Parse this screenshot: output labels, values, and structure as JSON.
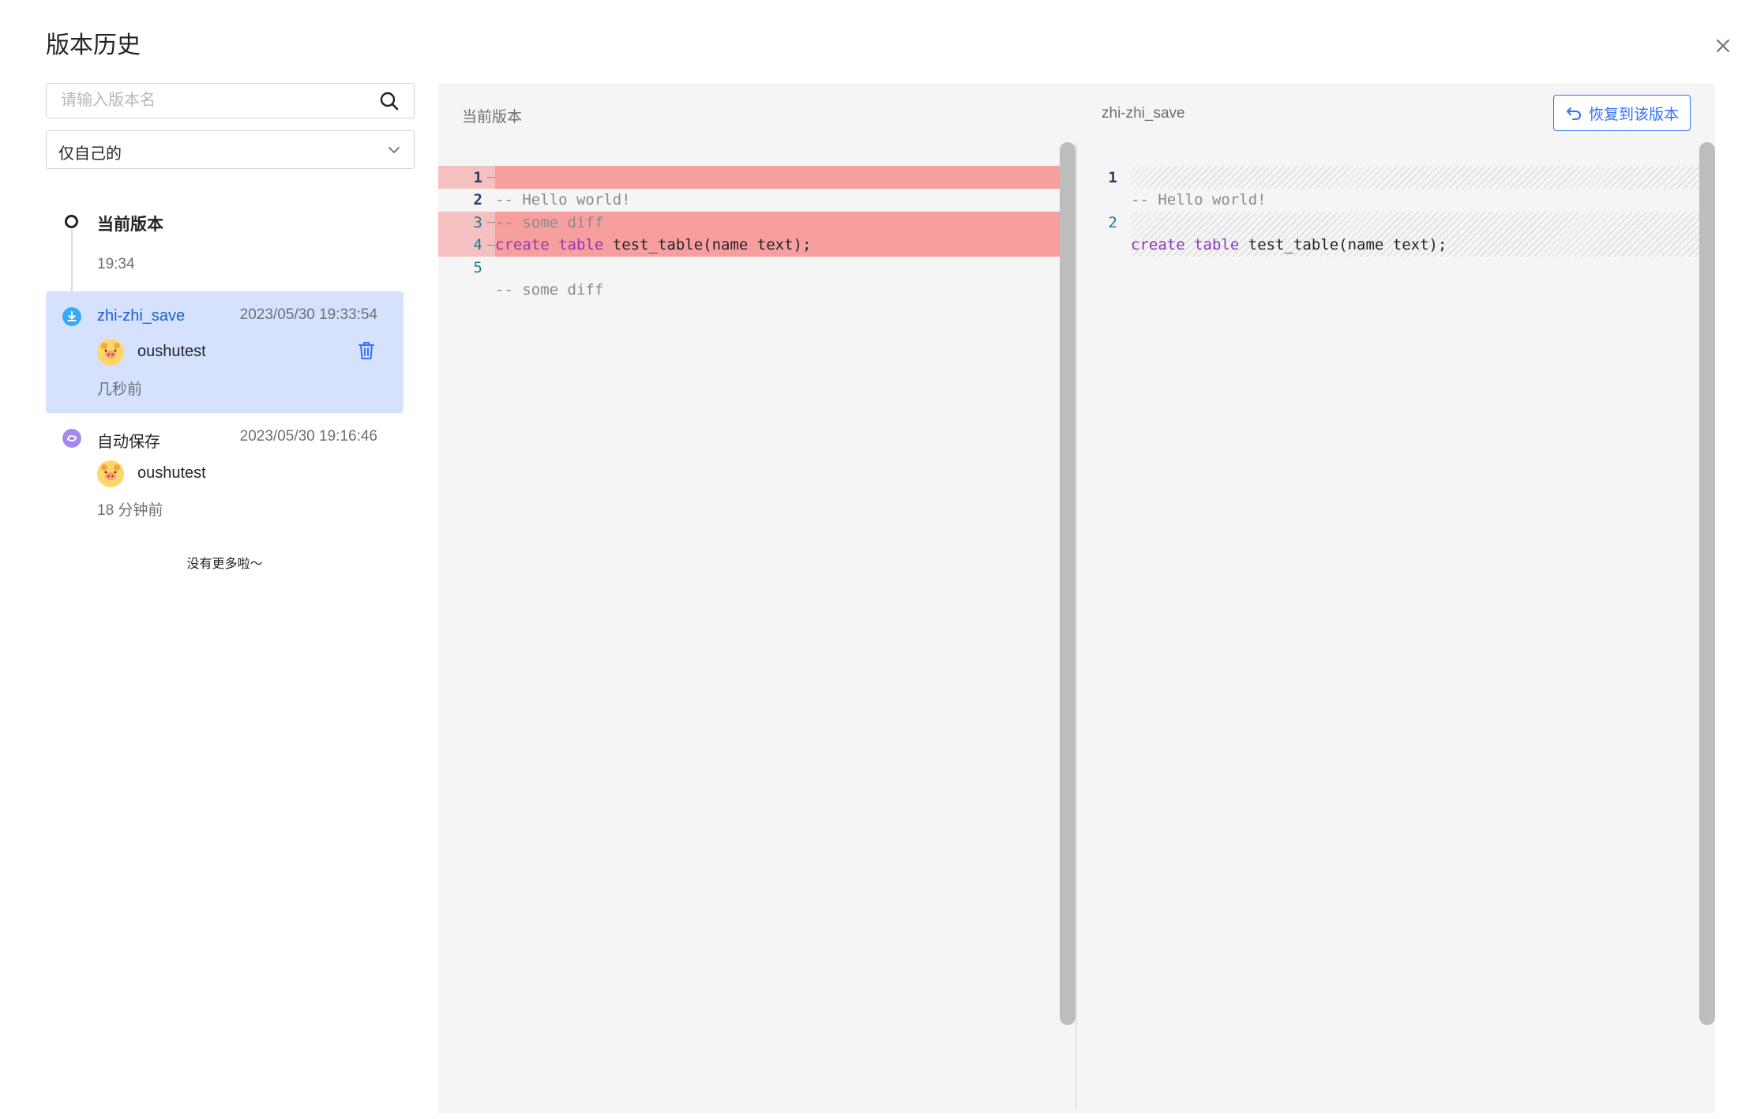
{
  "dialog": {
    "title": "版本历史",
    "close_icon": "close-icon"
  },
  "search": {
    "placeholder": "请输入版本名",
    "icon": "search-icon"
  },
  "filter": {
    "selected": "仅自己的",
    "icon": "chevron-down-icon"
  },
  "timeline": {
    "current": {
      "label": "当前版本",
      "time": "19:34"
    },
    "items": [
      {
        "name": "zhi-zhi_save",
        "date": "2023/05/30 19:33:54",
        "user": "oushutest",
        "relative": "几秒前",
        "icon": "manual-save-icon",
        "selected": true,
        "name_color": "#1a5fd6"
      },
      {
        "name": "自动保存",
        "date": "2023/05/30 19:16:46",
        "user": "oushutest",
        "relative": "18 分钟前",
        "icon": "auto-save-icon",
        "selected": false,
        "name_color": "#1f2329"
      }
    ],
    "no_more": "没有更多啦～"
  },
  "diff": {
    "left_title": "当前版本",
    "right_title": "zhi-zhi_save",
    "restore_label": "恢复到该版本",
    "restore_icon": "undo-icon",
    "left_lines": [
      {
        "n": "1",
        "text": "-- Hello world!"
      },
      {
        "n": "2",
        "text": "-- some diff"
      },
      {
        "n": "3",
        "kw1": "create",
        "kw2": "table",
        "rest": "test_table(name text);"
      },
      {
        "n": "4",
        "text": ""
      },
      {
        "n": "5",
        "text": "-- some diff"
      }
    ],
    "right_lines": [
      {
        "n": "1",
        "text": "-- Hello world!"
      },
      {
        "n": "2",
        "kw1": "create",
        "kw2": "table",
        "rest": "test_table(name text);"
      }
    ]
  },
  "colors": {
    "accent": "#3370ff",
    "selected_bg": "#d5e1fd",
    "deleted_line": "#f79f9f",
    "deleted_gutter": "#f5c0c0"
  }
}
